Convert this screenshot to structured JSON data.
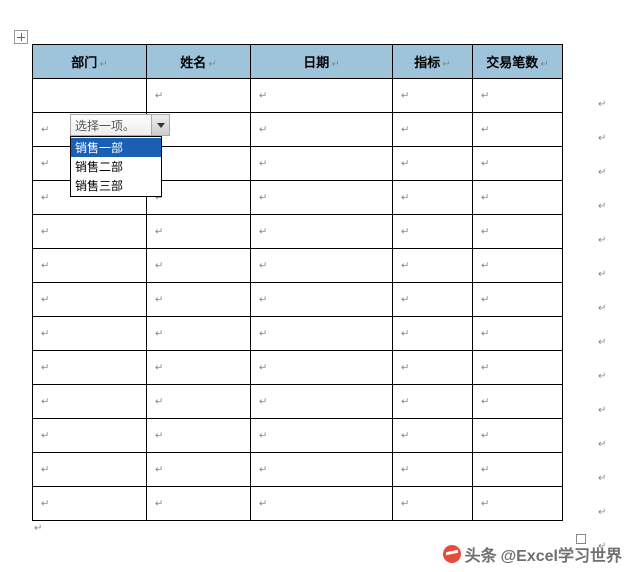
{
  "headers": {
    "col1": "部门",
    "col2": "姓名",
    "col3": "日期",
    "col4": "指标",
    "col5": "交易笔数"
  },
  "dropdown": {
    "placeholder": "选择一项。",
    "options": [
      "销售一部",
      "销售二部",
      "销售三部"
    ],
    "selected_index": 0
  },
  "para_mark": "↵",
  "row_count": 13,
  "watermark": {
    "prefix": "头条",
    "account": "@Excel学习世界"
  }
}
